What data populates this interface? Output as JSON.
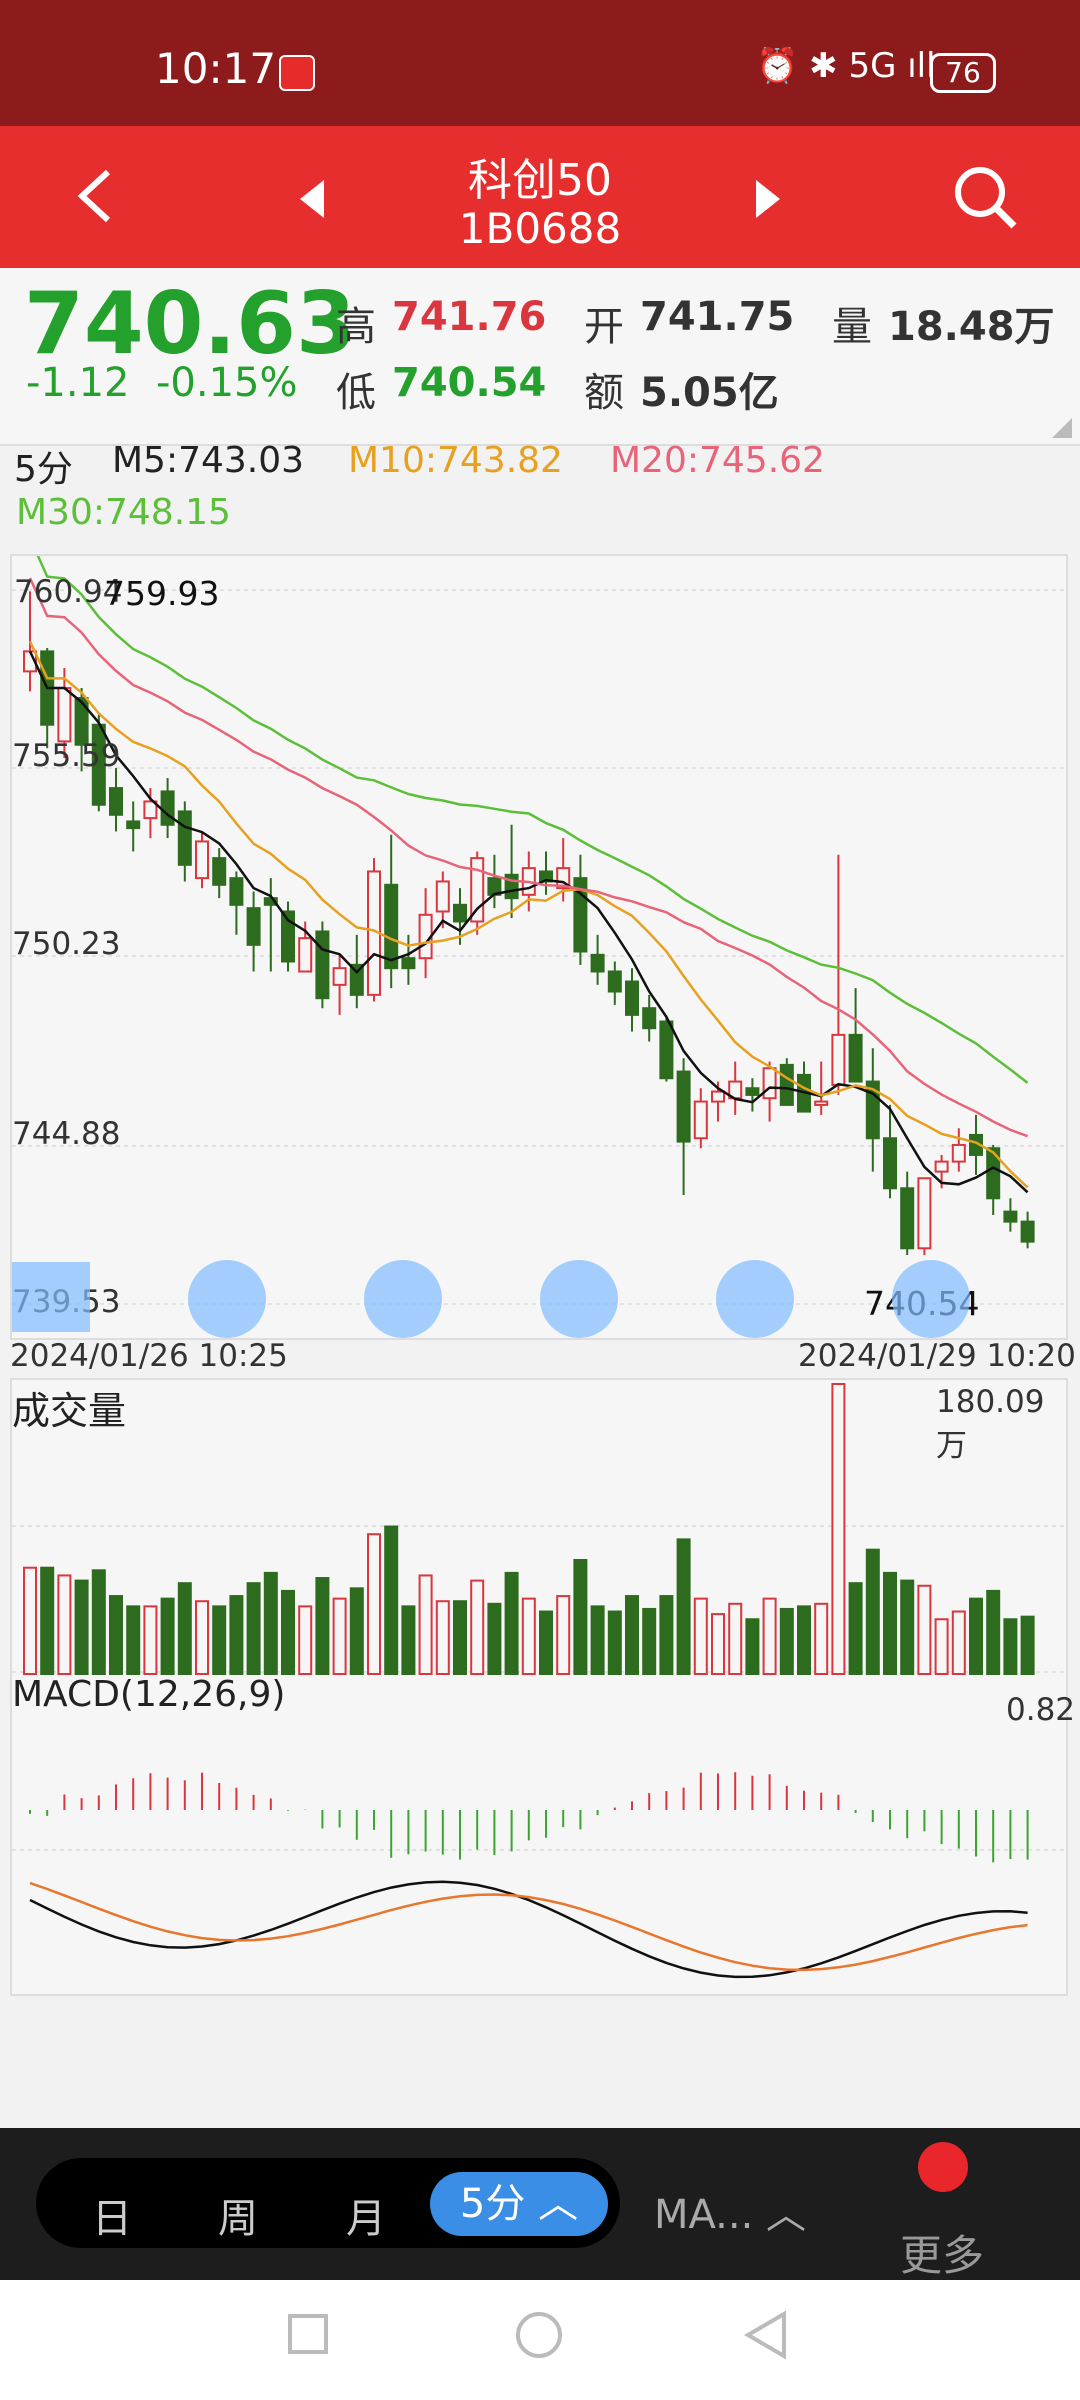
{
  "status_bar": {
    "time": "10:17",
    "indicators": "⏰ ✱ 5G ıll",
    "battery": "76"
  },
  "header": {
    "title": "科创50",
    "code": "1B0688"
  },
  "quote": {
    "price": "740.63",
    "change": "-1.12",
    "change_pct": "-0.15%",
    "high_label": "高",
    "high": "741.76",
    "low_label": "低",
    "low": "740.54",
    "open_label": "开",
    "open": "741.75",
    "amount_label": "额",
    "amount": "5.05亿",
    "volume_label": "量",
    "volume": "18.48万"
  },
  "ma_legend": {
    "period": "5分",
    "m5": "M5:743.03",
    "m10": "M10:743.82",
    "m20": "M20:745.62",
    "m30": "M30:748.15"
  },
  "price_chart": {
    "y_ticks": [
      "760.94",
      "755.59",
      "750.23",
      "744.88",
      "739.53"
    ],
    "high_marker": "759.93",
    "low_marker": "740.54",
    "start_time": "2024/01/26 10:25",
    "end_time": "2024/01/29 10:20"
  },
  "volume_chart": {
    "title": "成交量",
    "max_label": "180.09万"
  },
  "macd_chart": {
    "title": "MACD(12,26,9)",
    "max_label": "0.82"
  },
  "bottom_bar": {
    "periods": [
      "日",
      "周",
      "月"
    ],
    "selected_period": "5分 ︿",
    "indicator": "MA... ︿",
    "more": "更多"
  },
  "colors": {
    "up": "#d9363e",
    "down": "#2d6b1e",
    "m5": "#111111",
    "m10": "#e8a020",
    "m20": "#e86478",
    "m30": "#5cbf3a",
    "header": "#e62e2e"
  },
  "chart_data": {
    "type": "candlestick",
    "candles": [
      [
        758.5,
        760.9,
        757.9,
        759.1
      ],
      [
        759.1,
        759.2,
        756.2,
        756.9
      ],
      [
        756.4,
        758.6,
        755.9,
        758.0
      ],
      [
        757.7,
        758.0,
        755.5,
        756.3
      ],
      [
        756.9,
        757.2,
        754.3,
        754.5
      ],
      [
        755.0,
        755.6,
        753.7,
        754.2
      ],
      [
        754.0,
        754.6,
        753.1,
        753.8
      ],
      [
        754.1,
        755.0,
        753.5,
        754.6
      ],
      [
        754.9,
        755.3,
        753.5,
        753.9
      ],
      [
        754.3,
        754.6,
        752.2,
        752.7
      ],
      [
        752.3,
        753.7,
        752.0,
        753.4
      ],
      [
        752.9,
        753.2,
        751.7,
        752.1
      ],
      [
        752.3,
        752.5,
        750.6,
        751.5
      ],
      [
        751.4,
        751.9,
        749.5,
        750.3
      ],
      [
        751.7,
        752.3,
        749.5,
        751.5
      ],
      [
        751.3,
        751.6,
        749.5,
        749.8
      ],
      [
        749.5,
        751.0,
        749.5,
        750.5
      ],
      [
        750.7,
        751.0,
        748.4,
        748.7
      ],
      [
        749.1,
        750.0,
        748.2,
        749.6
      ],
      [
        749.7,
        750.6,
        748.4,
        748.8
      ],
      [
        748.8,
        752.9,
        748.6,
        752.5
      ],
      [
        752.1,
        753.6,
        749.0,
        749.6
      ],
      [
        749.9,
        750.6,
        749.1,
        749.6
      ],
      [
        749.9,
        752.0,
        749.3,
        751.2
      ],
      [
        751.3,
        752.5,
        750.8,
        752.2
      ],
      [
        751.5,
        752.0,
        750.3,
        751.0
      ],
      [
        751.0,
        753.1,
        750.6,
        752.9
      ],
      [
        752.3,
        753.0,
        751.4,
        751.8
      ],
      [
        752.4,
        753.9,
        751.1,
        751.7
      ],
      [
        751.8,
        753.1,
        751.3,
        752.6
      ],
      [
        752.5,
        753.1,
        751.8,
        752.2
      ],
      [
        752.0,
        753.5,
        751.6,
        752.6
      ],
      [
        752.3,
        753.0,
        749.7,
        750.1
      ],
      [
        750.0,
        750.6,
        749.1,
        749.5
      ],
      [
        749.5,
        749.8,
        748.5,
        748.9
      ],
      [
        749.2,
        749.6,
        747.7,
        748.2
      ],
      [
        748.4,
        748.8,
        747.4,
        747.8
      ],
      [
        748.0,
        748.1,
        746.2,
        746.3
      ],
      [
        746.5,
        746.9,
        742.8,
        744.4
      ],
      [
        744.5,
        746.0,
        744.2,
        745.6
      ],
      [
        745.6,
        746.2,
        745.0,
        745.9
      ],
      [
        745.7,
        746.8,
        745.2,
        746.2
      ],
      [
        746.0,
        746.3,
        745.3,
        745.8
      ],
      [
        745.7,
        746.8,
        745.0,
        746.6
      ],
      [
        746.7,
        746.9,
        745.5,
        745.5
      ],
      [
        746.4,
        746.8,
        745.3,
        745.3
      ],
      [
        745.5,
        746.8,
        745.2,
        745.6
      ],
      [
        746.1,
        753.0,
        745.8,
        747.6
      ],
      [
        747.6,
        749.0,
        746.6,
        746.2
      ],
      [
        746.2,
        747.2,
        743.5,
        744.5
      ],
      [
        744.5,
        745.5,
        742.7,
        743.0
      ],
      [
        743.0,
        743.5,
        741.0,
        741.2
      ],
      [
        741.2,
        743.3,
        741.0,
        743.3
      ],
      [
        743.5,
        744.0,
        743.0,
        743.8
      ],
      [
        743.8,
        744.8,
        743.5,
        744.3
      ],
      [
        744.6,
        745.2,
        743.4,
        744.0
      ],
      [
        744.2,
        744.3,
        742.2,
        742.7
      ],
      [
        742.3,
        742.7,
        741.7,
        742.0
      ],
      [
        742.0,
        742.3,
        741.2,
        741.4
      ]
    ],
    "ma5_last": 743.03,
    "ma10_last": 743.82,
    "ma20_last": 745.62,
    "ma30_last": 748.15,
    "volume_max": 180.09,
    "macd_max": 0.82
  }
}
